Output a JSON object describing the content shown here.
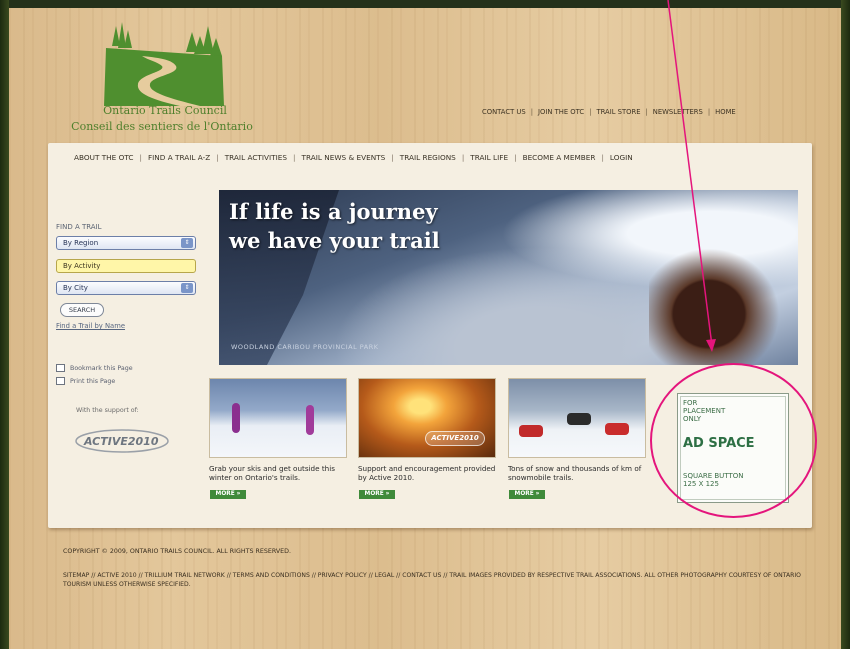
{
  "org": {
    "name_en": "Ontario Trails Council",
    "name_fr": "Conseil des sentiers de l'Ontario"
  },
  "top_links": [
    "CONTACT US",
    "JOIN THE OTC",
    "TRAIL STORE",
    "NEWSLETTERS",
    "HOME"
  ],
  "nav": [
    "ABOUT THE OTC",
    "FIND A TRAIL A-Z",
    "TRAIL ACTIVITIES",
    "TRAIL NEWS & EVENTS",
    "TRAIL REGIONS",
    "TRAIL LIFE",
    "BECOME A MEMBER",
    "LOGIN"
  ],
  "sidebar": {
    "find_title": "FIND A TRAIL",
    "selects": [
      "By Region",
      "By Activity",
      "By City"
    ],
    "search_label": "SEARCH",
    "find_by_name": "Find a Trail by Name",
    "bookmark": "Bookmark this Page",
    "print": "Print this Page",
    "support": "With the support of:",
    "active_logo": "ACTIVE2010"
  },
  "hero": {
    "line1": "If life is a journey",
    "line2": "we have your trail",
    "caption": "WOODLAND CARIBOU PROVINCIAL PARK"
  },
  "features": [
    {
      "text": "Grab your skis and get outside this winter on Ontario's trails.",
      "more": "MORE »"
    },
    {
      "text": "Support and encouragement provided by Active 2010.",
      "more": "MORE »",
      "badge": "ACTIVE2010"
    },
    {
      "text": "Tons of snow and thousands of km of snowmobile trails.",
      "more": "MORE »"
    }
  ],
  "ad": {
    "fpo": "FOR\nPLACEMENT\nONLY",
    "title": "AD SPACE",
    "sub": "SQUARE BUTTON\n125 X 125"
  },
  "footer": {
    "copyright": "COPYRIGHT © 2009, ONTARIO TRAILS COUNCIL. ALL RIGHTS RESERVED.",
    "sitemap": "SITEMAP // ACTIVE 2010 // TRILLIUM TRAIL NETWORK // TERMS AND CONDITIONS // PRIVACY POLICY // LEGAL // CONTACT US // TRAIL IMAGES PROVIDED BY RESPECTIVE TRAIL ASSOCIATIONS. ALL OTHER PHOTOGRAPHY COURTESY OF ONTARIO TOURISM UNLESS OTHERWISE SPECIFIED."
  },
  "colors": {
    "brand_green": "#4f7f2c",
    "more_green": "#3f8a3a",
    "highlight_pink": "#e4157c",
    "card_bg": "#f5efe2"
  }
}
